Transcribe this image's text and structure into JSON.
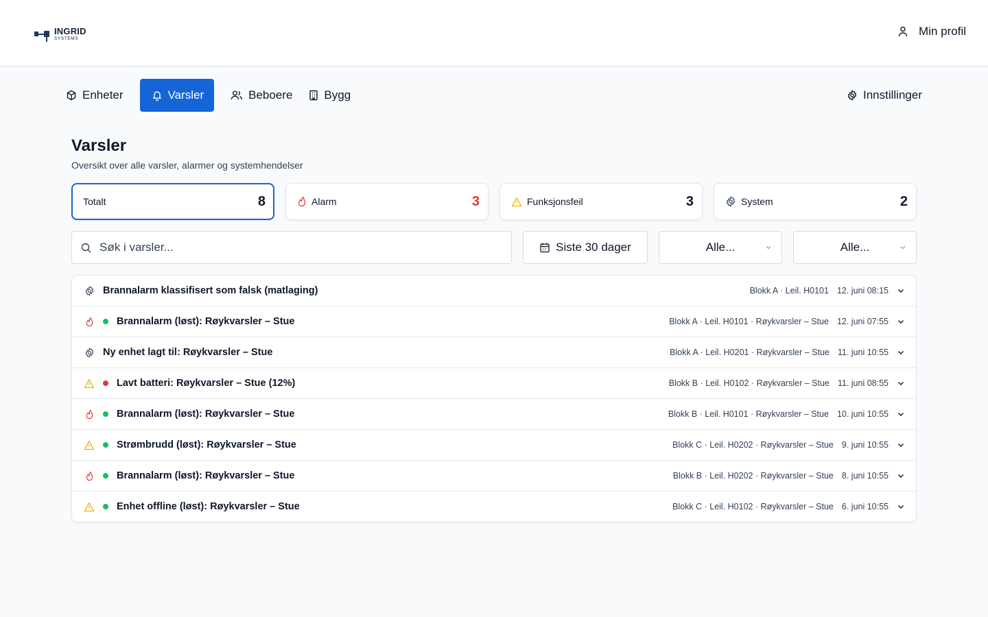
{
  "brand": {
    "name": "INGRID",
    "sub": "SYSTEMS"
  },
  "header": {
    "profile_label": "Min profil"
  },
  "nav": {
    "items": [
      {
        "label": "Enheter",
        "icon": "box-icon"
      },
      {
        "label": "Varsler",
        "icon": "bell-icon",
        "active": true
      },
      {
        "label": "Beboere",
        "icon": "users-icon"
      },
      {
        "label": "Bygg",
        "icon": "building-icon"
      }
    ],
    "settings_label": "Innstillinger"
  },
  "page": {
    "title": "Varsler",
    "subtitle": "Oversikt over alle varsler, alarmer og systemhendelser"
  },
  "stats": [
    {
      "label": "Totalt",
      "count": "8",
      "active": true
    },
    {
      "label": "Alarm",
      "count": "3",
      "icon": "flame-icon"
    },
    {
      "label": "Funksjonsfeil",
      "count": "3",
      "icon": "warning-icon"
    },
    {
      "label": "System",
      "count": "2",
      "icon": "gear-icon"
    }
  ],
  "filters": {
    "search_placeholder": "Søk i varsler...",
    "date_label": "Siste 30 dager",
    "select1_value": "Alle...",
    "select2_value": "Alle..."
  },
  "colors": {
    "accent": "#1565d8",
    "alarm": "#e5383b",
    "warning": "#eab308",
    "resolved": "#16c060"
  },
  "alerts": [
    {
      "type": "system",
      "status": "",
      "title": "Brannalarm klassifisert som falsk (matlaging)",
      "location": "Blokk A · Leil. H0101",
      "time": "12. juni 08:15"
    },
    {
      "type": "alarm",
      "status": "green",
      "title": "Brannalarm (løst): Røykvarsler – Stue",
      "location": "Blokk A · Leil. H0101 · Røykvarsler – Stue",
      "time": "12. juni 07:55"
    },
    {
      "type": "system",
      "status": "",
      "title": "Ny enhet lagt til: Røykvarsler – Stue",
      "location": "Blokk A · Leil. H0201 · Røykvarsler – Stue",
      "time": "11. juni 10:55"
    },
    {
      "type": "warning",
      "status": "red",
      "title": "Lavt batteri: Røykvarsler – Stue (12%)",
      "location": "Blokk B · Leil. H0102 · Røykvarsler – Stue",
      "time": "11. juni 08:55"
    },
    {
      "type": "alarm",
      "status": "green",
      "title": "Brannalarm (løst): Røykvarsler – Stue",
      "location": "Blokk B · Leil. H0101 · Røykvarsler – Stue",
      "time": "10. juni 10:55"
    },
    {
      "type": "warning",
      "status": "green",
      "title": "Strømbrudd (løst): Røykvarsler – Stue",
      "location": "Blokk C · Leil. H0202 · Røykvarsler – Stue",
      "time": "9. juni 10:55"
    },
    {
      "type": "alarm",
      "status": "green",
      "title": "Brannalarm (løst): Røykvarsler – Stue",
      "location": "Blokk B · Leil. H0202 · Røykvarsler – Stue",
      "time": "8. juni 10:55"
    },
    {
      "type": "warning",
      "status": "green",
      "title": "Enhet offline (løst): Røykvarsler – Stue",
      "location": "Blokk C · Leil. H0102 · Røykvarsler – Stue",
      "time": "6. juni 10:55"
    }
  ]
}
